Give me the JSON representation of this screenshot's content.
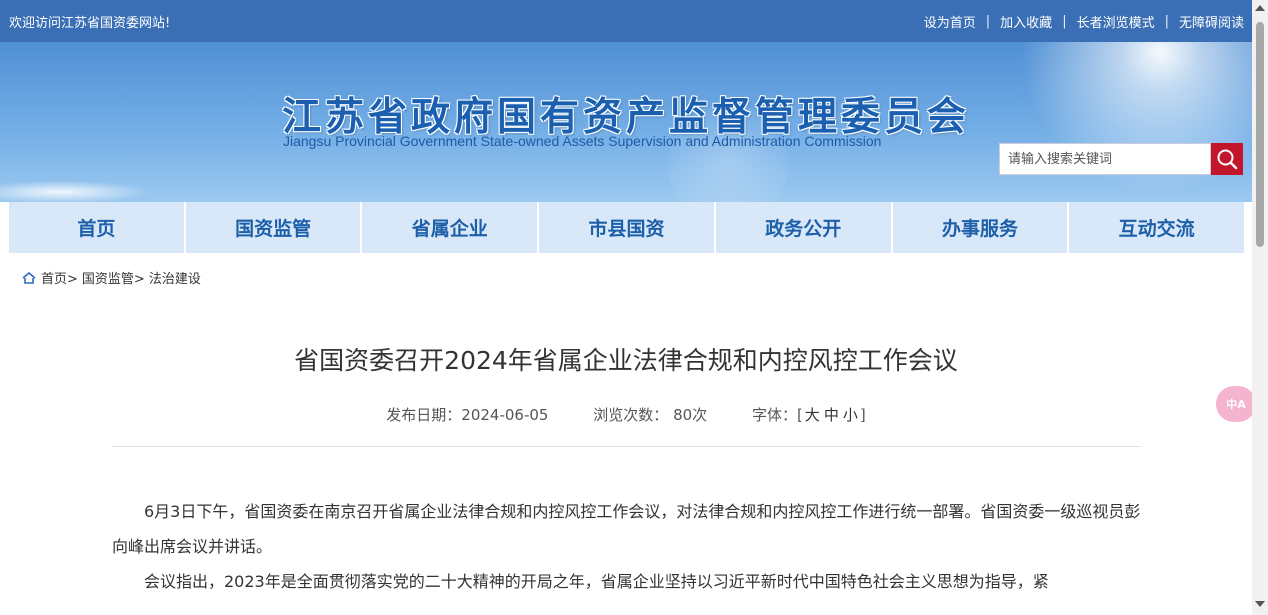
{
  "topbar": {
    "welcome": "欢迎访问江苏省国资委网站!",
    "links": [
      "设为首页",
      "加入收藏",
      "长者浏览模式",
      "无障碍阅读"
    ],
    "separator": "|"
  },
  "banner": {
    "title": "江苏省政府国有资产监督管理委员会",
    "subtitle": "Jiangsu Provincial Government State-owned Assets Supervision and Administration Commission"
  },
  "search": {
    "placeholder": "请输入搜索关键词",
    "icon": "search-icon"
  },
  "nav": {
    "items": [
      "首页",
      "国资监管",
      "省属企业",
      "市县国资",
      "政务公开",
      "办事服务",
      "互动交流"
    ]
  },
  "breadcrumb": {
    "icon": "home-icon",
    "items": [
      "首页>",
      "国资监管>",
      "法治建设"
    ]
  },
  "article": {
    "title": "省国资委召开2024年省属企业法律合规和内控风控工作会议",
    "publish_label": "发布日期：",
    "publish_date": "2024-06-05",
    "views_label": "浏览次数：",
    "views": "80次",
    "font_label": "字体：[",
    "font_sizes": [
      "大",
      "中",
      "小"
    ],
    "font_close": "]",
    "paragraphs": [
      "6月3日下午，省国资委在南京召开省属企业法律合规和内控风控工作会议，对法律合规和内控风控工作进行统一部署。省国资委一级巡视员彭向峰出席会议并讲话。",
      "会议指出，2023年是全面贯彻落实党的二十大精神的开局之年，省属企业坚持以习近平新时代中国特色社会主义思想为指导，紧"
    ]
  },
  "translate_button": {
    "label": "中A",
    "icon": "translate-icon"
  },
  "colors": {
    "topbar": "#3a6fb5",
    "nav_bg": "#d8e8f8",
    "nav_text": "#1d5fa8",
    "search_button": "#c4162a"
  }
}
